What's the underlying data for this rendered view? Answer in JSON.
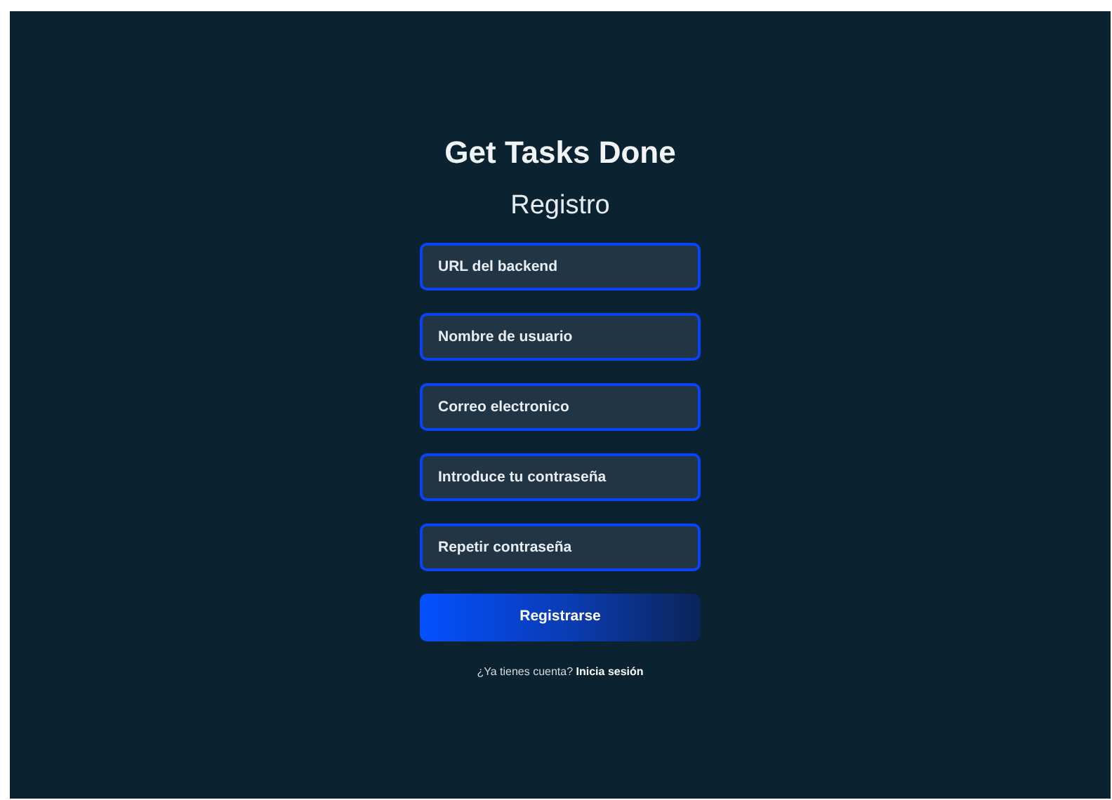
{
  "app_title": "Get Tasks Done",
  "form_title": "Registro",
  "fields": [
    {
      "placeholder": "URL del backend"
    },
    {
      "placeholder": "Nombre de usuario"
    },
    {
      "placeholder": "Correo electronico"
    },
    {
      "placeholder": "Introduce tu contraseña"
    },
    {
      "placeholder": "Repetir contraseña"
    }
  ],
  "submit_button": "Registrarse",
  "footer": {
    "prompt": "¿Ya tienes cuenta?",
    "link": "Inicia sesión"
  }
}
